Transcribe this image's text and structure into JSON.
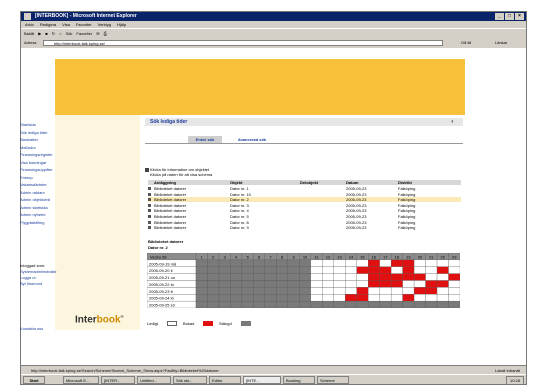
{
  "window": {
    "title": "[INTERBOOK] - Microsoft Internet Explorer",
    "buttons": [
      "_",
      "□",
      "×"
    ]
  },
  "menu": [
    "Arkiv",
    "Redigera",
    "Visa",
    "Favoriter",
    "Verktyg",
    "Hjälp"
  ],
  "toolbar": [
    "Bakåt",
    "Sök",
    "Favoriter"
  ],
  "address": {
    "label": "Adress",
    "url": "http://interbook.falk.kping.se/",
    "go": "Gå till",
    "links": "Länkar"
  },
  "colors": {
    "banner": "#f7c23a",
    "sidebar": "#fdf6df",
    "booked": "#e01010",
    "blocked": "#7a7a7a",
    "free": "#ffffff",
    "link": "#1b3b9b",
    "highlight": "#fbe9b8"
  },
  "sidebar": {
    "items": [
      "Startsida",
      "Sök lediga tider",
      "Blankatter",
      "Maßsdur",
      "Finansingsregister",
      "Visa bokningar",
      "Finansingsuppifter",
      "Enkrep",
      "Vakansdärtstre",
      "Admin raktam",
      "Admin objektoträ",
      "Admin startsida",
      "Admin nyheter",
      "Flygplatsfilmg"
    ],
    "login": [
      "Inloggad som:",
      "Systemadministratör",
      "Logga ut",
      "Byt lösenord"
    ],
    "logo_a": "Inter",
    "logo_b": "book",
    "logo_mark": "®",
    "contact": "Kontakta oss"
  },
  "main": {
    "title": "Sök lediga tider",
    "help": "?",
    "tabs": [
      "Enkel sök",
      "Avancerad sök"
    ],
    "info": [
      "Klicka för information om objektet",
      "Klicka på raden för att visa schema"
    ]
  },
  "table": {
    "headers": [
      "Anläggning",
      "Objekt",
      "Delobjekt",
      "Datum",
      "Distrikt"
    ],
    "rows": [
      [
        "Biblioteket datorer",
        "Dator nr. 1",
        "",
        "2005-09-23",
        "Falköping"
      ],
      [
        "Biblioteket datorer",
        "Dator nr. 10",
        "",
        "2005-09-23",
        "Falköping"
      ],
      [
        "Biblioteket datorer",
        "Dator nr. 2",
        "",
        "2005-09-23",
        "Falköping"
      ],
      [
        "Biblioteket datorer",
        "Dator nr. 3",
        "",
        "2005-09-23",
        "Falköping"
      ],
      [
        "Biblioteket datorer",
        "Dator nr. 4",
        "",
        "2005-09-23",
        "Falköping"
      ],
      [
        "Biblioteket datorer",
        "Dator nr. 5",
        "",
        "2005-09-23",
        "Falköping"
      ],
      [
        "Biblioteket datorer",
        "Dator nr. 8",
        "",
        "2005-09-23",
        "Falköping"
      ],
      [
        "Biblioteket datorer",
        "Dator nr. 9",
        "",
        "2005-09-23",
        "Falköping"
      ]
    ],
    "selected_row": 2
  },
  "schedule": {
    "title": "Biblioteket datorer",
    "subtitle": "Dator nr. 2",
    "corner": "Vecka 39",
    "hours": [
      "1",
      "2",
      "3",
      "4",
      "5",
      "6",
      "7",
      "8",
      "9",
      "10",
      "11",
      "12",
      "13",
      "14",
      "15",
      "16",
      "17",
      "18",
      "19",
      "20",
      "21",
      "22",
      "23"
    ],
    "days": [
      "2005-09-19 må",
      "2005-09-20 ti",
      "2005-09-21 on",
      "2005-09-22 to",
      "2005-09-23 fr",
      "2005-09-24 lö",
      "2005-09-25 sö"
    ],
    "grid": [
      "BBBBBBBBBBFFFFFRFRRFFFFF",
      "BBBBBBBBBBFFFFRRRFRFFRFF",
      "BBBBBBBBBBFFFFFRRRRRFFRB",
      "BBBBBBBBBBFFFFFRRRFFRRFB",
      "BBBBBBBBBBFFFFRFFFFRRFFB",
      "BBBBBBBBBBFFFRRFFFRFFFFB",
      "BBBBBBBBBBBBBBBBBBBBBBBB"
    ]
  },
  "legend": {
    "free": "Ledigt",
    "booked": "Bokad",
    "blocked": "Stängd"
  },
  "status": {
    "url": "http://interbook.falk.kping.se/Search/Scheme/Search_Scheme_Show.aspx?Facility=Biblioteket%20datorer",
    "zone": "Lokalt intranät"
  },
  "taskbar": {
    "start": "Start",
    "tasks": [
      "Microsoft E...",
      "[INTER...",
      "Untitled...",
      "Sök skr...",
      "Editor",
      "[INTE...",
      "Booking",
      "Scheme"
    ],
    "active": 5,
    "time": "10:28"
  }
}
